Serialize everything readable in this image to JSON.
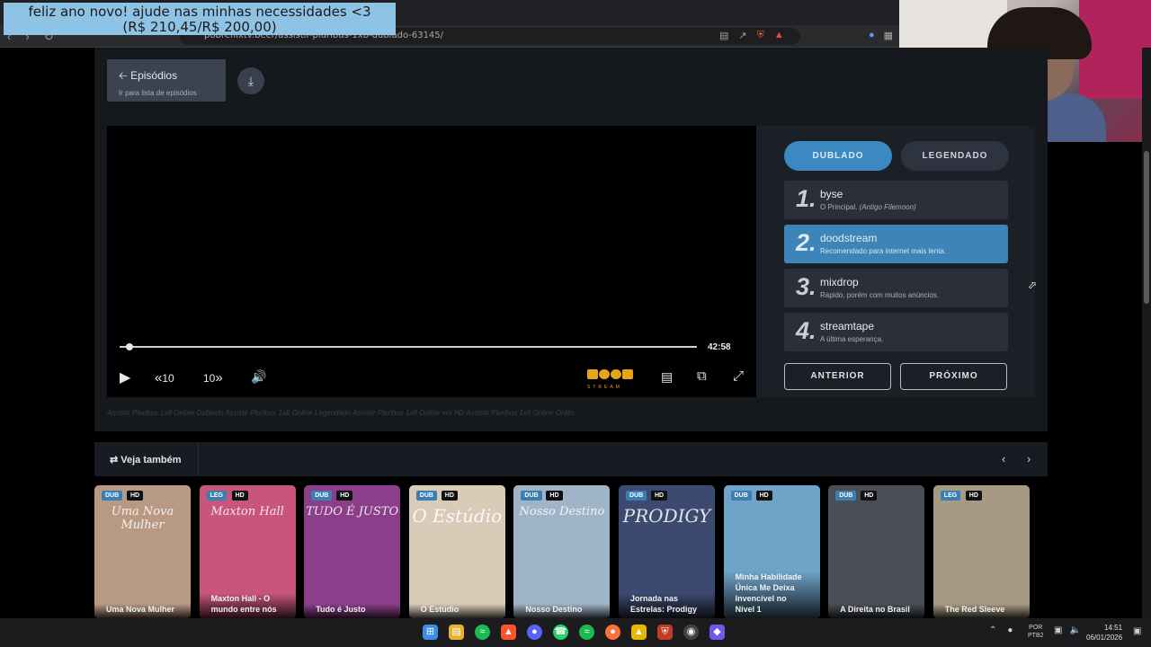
{
  "banner": {
    "line1": "feliz ano novo! ajude nas minhas necessidades <3",
    "line2": "(R$ 210,45/R$ 200,00)"
  },
  "browser": {
    "url": "pobreflixtv.beer/assistir-pluribus-1x8-dublado-63145/",
    "icons": [
      "back-icon",
      "forward-icon",
      "reload-icon",
      "bookmark-icon",
      "reader-icon",
      "share-icon",
      "brave-shield-icon",
      "brave-rewards-icon"
    ]
  },
  "episodes_button": {
    "title": "Episódios",
    "subtitle": "Ir para lista de episódios"
  },
  "player": {
    "duration": "42:58",
    "rewind_label": "10",
    "forward_label": "10",
    "progress_fraction": 0.01,
    "brand": "STREAM"
  },
  "languages": {
    "dub": "DUBLADO",
    "leg": "LEGENDADO"
  },
  "servers": [
    {
      "num": "1.",
      "name": "byse",
      "desc": "O Principal.",
      "desc_em": "(Antigo Filemoon)"
    },
    {
      "num": "2.",
      "name": "doodstream",
      "desc": "Recomendado para internet mais lenta.",
      "desc_em": ""
    },
    {
      "num": "3.",
      "name": "mixdrop",
      "desc": "Rápido, porém com muitos anúncios.",
      "desc_em": ""
    },
    {
      "num": "4.",
      "name": "streamtape",
      "desc": "A última esperança.",
      "desc_em": ""
    }
  ],
  "nav_buttons": {
    "prev": " ANTERIOR",
    "next": "PRÓXIMO "
  },
  "seo_text": "Assistir Pluribus 1x8 Online Dublado Assistir Pluribus 1x8 Online Legendado Assistir Pluribus 1x8 Online em HD Assistir Pluribus 1x8 Online Grátis",
  "see_also": {
    "title": "Veja também",
    "cards": [
      {
        "type": "DUB",
        "quality": "HD",
        "title": "Uma Nova Mulher",
        "art": "Uma Nova Mulher",
        "bg": "#b89a84"
      },
      {
        "type": "LEG",
        "quality": "HD",
        "title": "Maxton Hall - O mundo entre nós",
        "art": "Maxton Hall",
        "bg": "#c8567a"
      },
      {
        "type": "DUB",
        "quality": "HD",
        "title": "Tudo é Justo",
        "art": "TUDO É JUSTO",
        "bg": "#8b3f8a"
      },
      {
        "type": "DUB",
        "quality": "HD",
        "title": "O Estúdio",
        "art": "O Estúdio",
        "bg": "#d9cbb8"
      },
      {
        "type": "DUB",
        "quality": "HD",
        "title": "Nosso Destino",
        "art": "Nosso Destino",
        "bg": "#9fb4c6"
      },
      {
        "type": "DUB",
        "quality": "HD",
        "title": "Jornada nas Estrelas: Prodigy",
        "art": "PRODIGY",
        "bg": "#3b4a6e"
      },
      {
        "type": "DUB",
        "quality": "HD",
        "title": "Minha Habilidade Única Me Deixa Invencível no Nível 1",
        "art": "",
        "bg": "#6fa3c8"
      },
      {
        "type": "DUB",
        "quality": "HD",
        "title": "A Direita no Brasil",
        "art": "",
        "bg": "#4a4e55"
      },
      {
        "type": "LEG",
        "quality": "HD",
        "title": "The Red Sleeve",
        "art": "",
        "bg": "#a69a82"
      }
    ]
  },
  "taskbar": {
    "lang_line1": "POR",
    "lang_line2": "PTB2",
    "time": "14:51",
    "date": "06/01/2026"
  },
  "colors": {
    "accent": "#3c88c2",
    "panel": "#2a2f39",
    "banner": "#8fc3e6"
  }
}
